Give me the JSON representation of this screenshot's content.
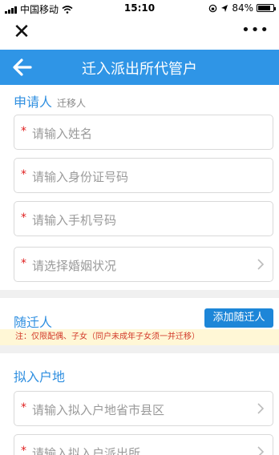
{
  "status_bar": {
    "carrier": "中国移动",
    "time": "15:10",
    "battery_percent": "84%",
    "battery_level": 0.84
  },
  "title_bar": {
    "close_icon": "✕",
    "more_icon": "•••"
  },
  "header": {
    "title": "迁入派出所代管户"
  },
  "applicant": {
    "title": "申请人",
    "subtitle": "迁移人",
    "fields": [
      {
        "placeholder": "请输入姓名",
        "required": "*"
      },
      {
        "placeholder": "请输入身份证号码",
        "required": "*"
      },
      {
        "placeholder": "请输入手机号码",
        "required": "*"
      },
      {
        "placeholder": "请选择婚姻状况",
        "required": "*"
      }
    ]
  },
  "companion": {
    "title": "随迁人",
    "add_button": "添加随迁人",
    "notice": "注：仅限配偶、子女（同户未成年子女须一并迁移）"
  },
  "destination": {
    "title": "拟入户地",
    "fields": [
      {
        "placeholder": "请输入拟入户地省市县区",
        "required": "*"
      },
      {
        "placeholder": "请输入拟入户派出所",
        "required": "*"
      }
    ]
  },
  "colors": {
    "header_bg": "#2f95e6",
    "section_title": "#2f8fe0",
    "button_bg": "#1d86d8",
    "required_star": "#e02020",
    "notice_text": "#d23a2a",
    "notice_bg": "#fff7d6"
  }
}
